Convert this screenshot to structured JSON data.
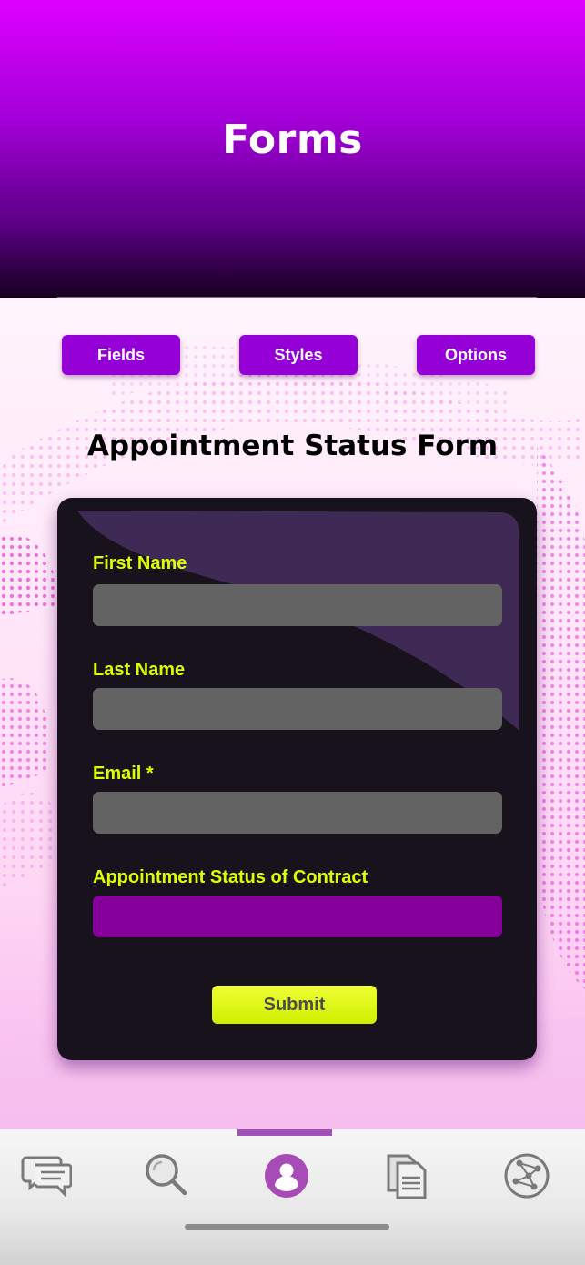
{
  "header": {
    "title": "Forms"
  },
  "tabs": [
    {
      "label": "Fields"
    },
    {
      "label": "Styles"
    },
    {
      "label": "Options"
    }
  ],
  "form": {
    "title": "Appointment Status Form",
    "fields": [
      {
        "label": "First  Name",
        "value": ""
      },
      {
        "label": "Last Name",
        "value": ""
      },
      {
        "label": "Email *",
        "value": ""
      },
      {
        "label": "Appointment Status of Contract",
        "value": ""
      }
    ],
    "submit_label": "Submit"
  },
  "bottom_nav": {
    "items": [
      {
        "icon": "chat-icon"
      },
      {
        "icon": "search-icon"
      },
      {
        "icon": "profile-icon",
        "active": true
      },
      {
        "icon": "documents-icon"
      },
      {
        "icon": "network-icon"
      }
    ]
  },
  "colors": {
    "accent": "#9400d6",
    "label": "#dcff00",
    "card": "#17121b",
    "input": "#636363",
    "select": "#85009a",
    "submit": "#dcff00",
    "nav_active": "#a050b8"
  }
}
